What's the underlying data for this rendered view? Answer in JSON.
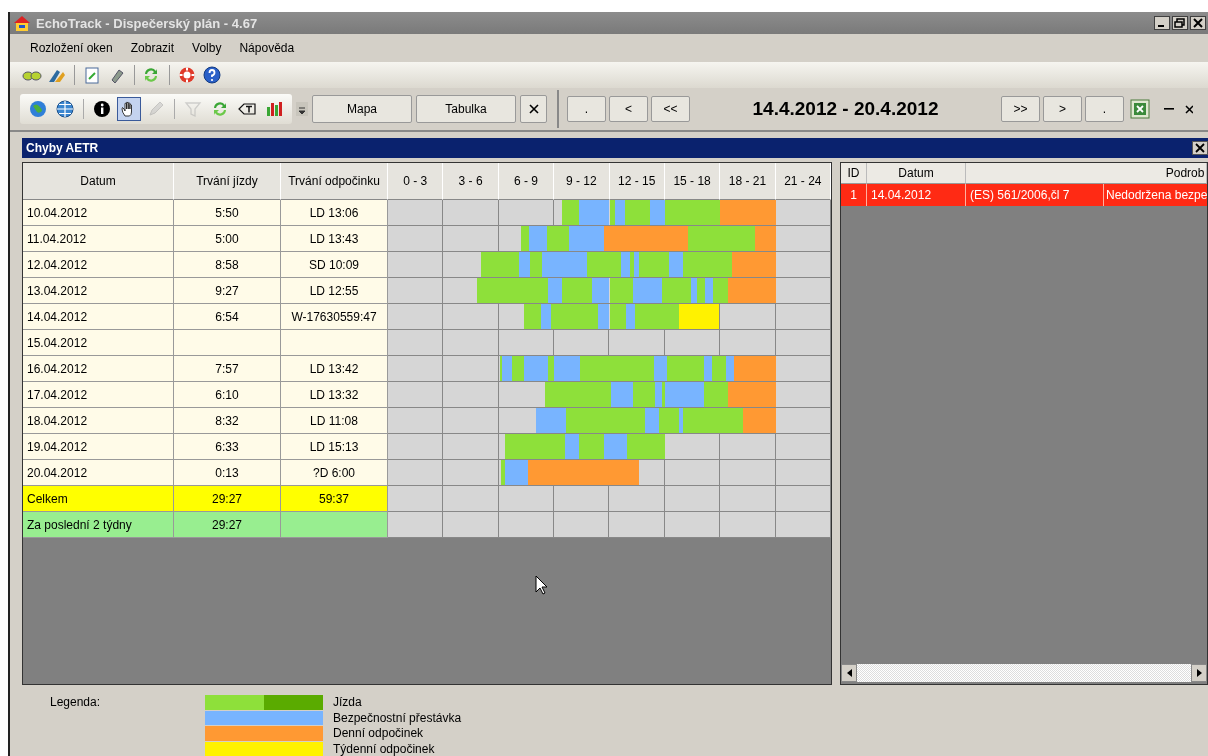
{
  "window": {
    "title": "EchoTrack - Dispečerský plán - 4.67"
  },
  "menu": [
    "Rozložení oken",
    "Zobrazit",
    "Volby",
    "Nápověda"
  ],
  "toolbar": {
    "tool_groups": [
      [
        {
          "kind": "globe",
          "selected": false,
          "disabled": false
        },
        {
          "kind": "globe-grid",
          "selected": false,
          "disabled": false
        }
      ],
      [
        {
          "kind": "info",
          "selected": false,
          "disabled": false
        },
        {
          "kind": "hand",
          "selected": true,
          "disabled": false
        },
        {
          "kind": "pencil",
          "selected": false,
          "disabled": true
        }
      ],
      [
        {
          "kind": "filter",
          "selected": false,
          "disabled": true
        },
        {
          "kind": "refresh",
          "selected": false,
          "disabled": false
        },
        {
          "kind": "text-tag",
          "selected": false,
          "disabled": false
        },
        {
          "kind": "chart",
          "selected": false,
          "disabled": false
        }
      ]
    ],
    "view_buttons": [
      "Mapa",
      "Tabulka"
    ]
  },
  "date_nav": {
    "buttons_left": [
      ".",
      "<",
      "<<"
    ],
    "range": "14.4.2012 - 20.4.2012",
    "buttons_right": [
      ">>",
      ">",
      "."
    ]
  },
  "panel": {
    "title": "Chyby AETR"
  },
  "table": {
    "columns": [
      "Datum",
      "Trvání jízdy",
      "Trvání odpočinku"
    ],
    "hour_columns": [
      "0 - 3",
      "3 - 6",
      "6 - 9",
      "9 - 12",
      "12 - 15",
      "15 - 18",
      "18 - 21",
      "21 - 24"
    ],
    "rows": [
      {
        "date": "10.04.2012",
        "drive": "5:50",
        "rest": "LD 13:06",
        "segments": [
          {
            "kind": "drive"
          },
          {
            "kind": "break"
          },
          {
            "kind": "drive"
          },
          {
            "kind": "break"
          },
          {
            "kind": "drive"
          },
          {
            "kind": "break"
          },
          {
            "kind": "drive"
          },
          {
            "kind": "daily"
          }
        ]
      },
      {
        "date": "11.04.2012",
        "drive": "5:00",
        "rest": "LD 13:43",
        "segments": [
          {
            "kind": "drive"
          },
          {
            "kind": "break"
          },
          {
            "kind": "drive"
          },
          {
            "kind": "break"
          },
          {
            "kind": "daily"
          },
          {
            "kind": "drive"
          },
          {
            "kind": "daily"
          }
        ]
      },
      {
        "date": "12.04.2012",
        "drive": "8:58",
        "rest": "SD 10:09",
        "segments": [
          {
            "kind": "drive"
          },
          {
            "kind": "break"
          },
          {
            "kind": "drive"
          },
          {
            "kind": "break"
          },
          {
            "kind": "drive"
          },
          {
            "kind": "break"
          },
          {
            "kind": "drive"
          },
          {
            "kind": "break"
          },
          {
            "kind": "drive"
          },
          {
            "kind": "break"
          },
          {
            "kind": "drive"
          },
          {
            "kind": "daily"
          }
        ]
      },
      {
        "date": "13.04.2012",
        "drive": "9:27",
        "rest": "LD 12:55",
        "segments": [
          {
            "kind": "drive"
          },
          {
            "kind": "break"
          },
          {
            "kind": "drive"
          },
          {
            "kind": "break"
          },
          {
            "kind": "drive"
          },
          {
            "kind": "break"
          },
          {
            "kind": "drive"
          },
          {
            "kind": "break"
          },
          {
            "kind": "drive"
          },
          {
            "kind": "break"
          },
          {
            "kind": "drive"
          },
          {
            "kind": "daily"
          }
        ]
      },
      {
        "date": "14.04.2012",
        "drive": "6:54",
        "rest": "W-17630559:47",
        "segments": [
          {
            "kind": "drive"
          },
          {
            "kind": "break"
          },
          {
            "kind": "drive"
          },
          {
            "kind": "break"
          },
          {
            "kind": "drive"
          },
          {
            "kind": "break"
          },
          {
            "kind": "drive"
          },
          {
            "kind": "weekly"
          }
        ]
      },
      {
        "date": "15.04.2012"
      },
      {
        "date": "16.04.2012",
        "drive": "7:57",
        "rest": "LD 13:42",
        "segments": [
          {
            "kind": "drive"
          },
          {
            "kind": "break"
          },
          {
            "kind": "drive"
          },
          {
            "kind": "break"
          },
          {
            "kind": "drive"
          },
          {
            "kind": "break"
          },
          {
            "kind": "drive"
          },
          {
            "kind": "break"
          },
          {
            "kind": "drive"
          },
          {
            "kind": "break"
          },
          {
            "kind": "drive"
          },
          {
            "kind": "break"
          },
          {
            "kind": "daily"
          }
        ]
      },
      {
        "date": "17.04.2012",
        "drive": "6:10",
        "rest": "LD 13:32",
        "segments": [
          {
            "kind": "drive"
          },
          {
            "kind": "break"
          },
          {
            "kind": "drive"
          },
          {
            "kind": "break"
          },
          {
            "kind": "drive"
          },
          {
            "kind": "break"
          },
          {
            "kind": "drive"
          },
          {
            "kind": "daily"
          }
        ]
      },
      {
        "date": "18.04.2012",
        "drive": "8:32",
        "rest": "LD 11:08",
        "segments": [
          {
            "kind": "break"
          },
          {
            "kind": "drive"
          },
          {
            "kind": "break"
          },
          {
            "kind": "drive"
          },
          {
            "kind": "break"
          },
          {
            "kind": "drive"
          },
          {
            "kind": "daily"
          }
        ]
      },
      {
        "date": "19.04.2012",
        "drive": "6:33",
        "rest": "LD 15:13",
        "segments": [
          {
            "kind": "drive"
          },
          {
            "kind": "break"
          },
          {
            "kind": "drive"
          },
          {
            "kind": "break"
          },
          {
            "kind": "drive"
          }
        ]
      },
      {
        "date": "20.04.2012",
        "drive": "0:13",
        "rest": "?D 6:00",
        "segments": [
          {
            "kind": "drive"
          },
          {
            "kind": "break"
          },
          {
            "kind": "daily"
          }
        ]
      }
    ],
    "summary_rows": [
      {
        "kind": "total",
        "label": "Celkem",
        "drive": "29:27",
        "rest": "59:37"
      },
      {
        "kind": "fortnight",
        "label": "Za poslední 2 týdny",
        "drive": "29:27"
      }
    ]
  },
  "errors": {
    "columns": [
      "ID",
      "Datum",
      "Podrob"
    ],
    "rows": [
      {
        "id": "1",
        "date": "14.04.2012",
        "rule": "(ES) 561/2006,čl 7",
        "detail": "Nedodržena bezpe",
        "selected": true
      }
    ]
  },
  "legend": {
    "title": "Legenda:",
    "items": [
      {
        "kind": "drive",
        "label": "Jízda"
      },
      {
        "kind": "break",
        "label": "Bezpečnostní přestávka"
      },
      {
        "kind": "daily",
        "label": "Denní odpočinek"
      },
      {
        "kind": "weekly",
        "label": "Týdenní odpočinek"
      }
    ]
  }
}
